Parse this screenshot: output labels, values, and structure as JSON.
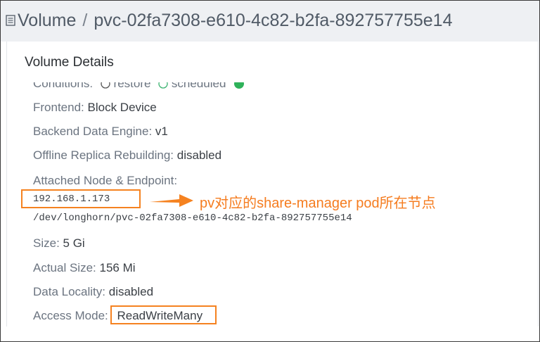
{
  "header": {
    "section": "Volume",
    "separator": "/",
    "volume_name": "pvc-02fa7308-e610-4c82-b2fa-892757755e14"
  },
  "details": {
    "title": "Volume Details",
    "conditions": {
      "label": "Conditions:",
      "items": [
        "restore",
        "scheduled"
      ]
    },
    "frontend": {
      "label": "Frontend:",
      "value": "Block Device"
    },
    "backend_engine": {
      "label": "Backend Data Engine:",
      "value": "v1"
    },
    "offline_rebuild": {
      "label": "Offline Replica Rebuilding:",
      "value": "disabled"
    },
    "attached": {
      "label": "Attached Node & Endpoint:",
      "node": "192.168.1.173",
      "endpoint": "/dev/longhorn/pvc-02fa7308-e610-4c82-b2fa-892757755e14"
    },
    "size": {
      "label": "Size:",
      "value": "5 Gi"
    },
    "actual_size": {
      "label": "Actual Size:",
      "value": "156 Mi"
    },
    "data_locality": {
      "label": "Data Locality:",
      "value": "disabled"
    },
    "access_mode": {
      "label": "Access Mode:",
      "value": "ReadWriteMany"
    }
  },
  "annotation": {
    "text": "pv对应的share-manager pod所在节点",
    "color": "#f57c1f"
  },
  "colors": {
    "highlight": "#f58220",
    "header_bg": "#eef0f3"
  }
}
